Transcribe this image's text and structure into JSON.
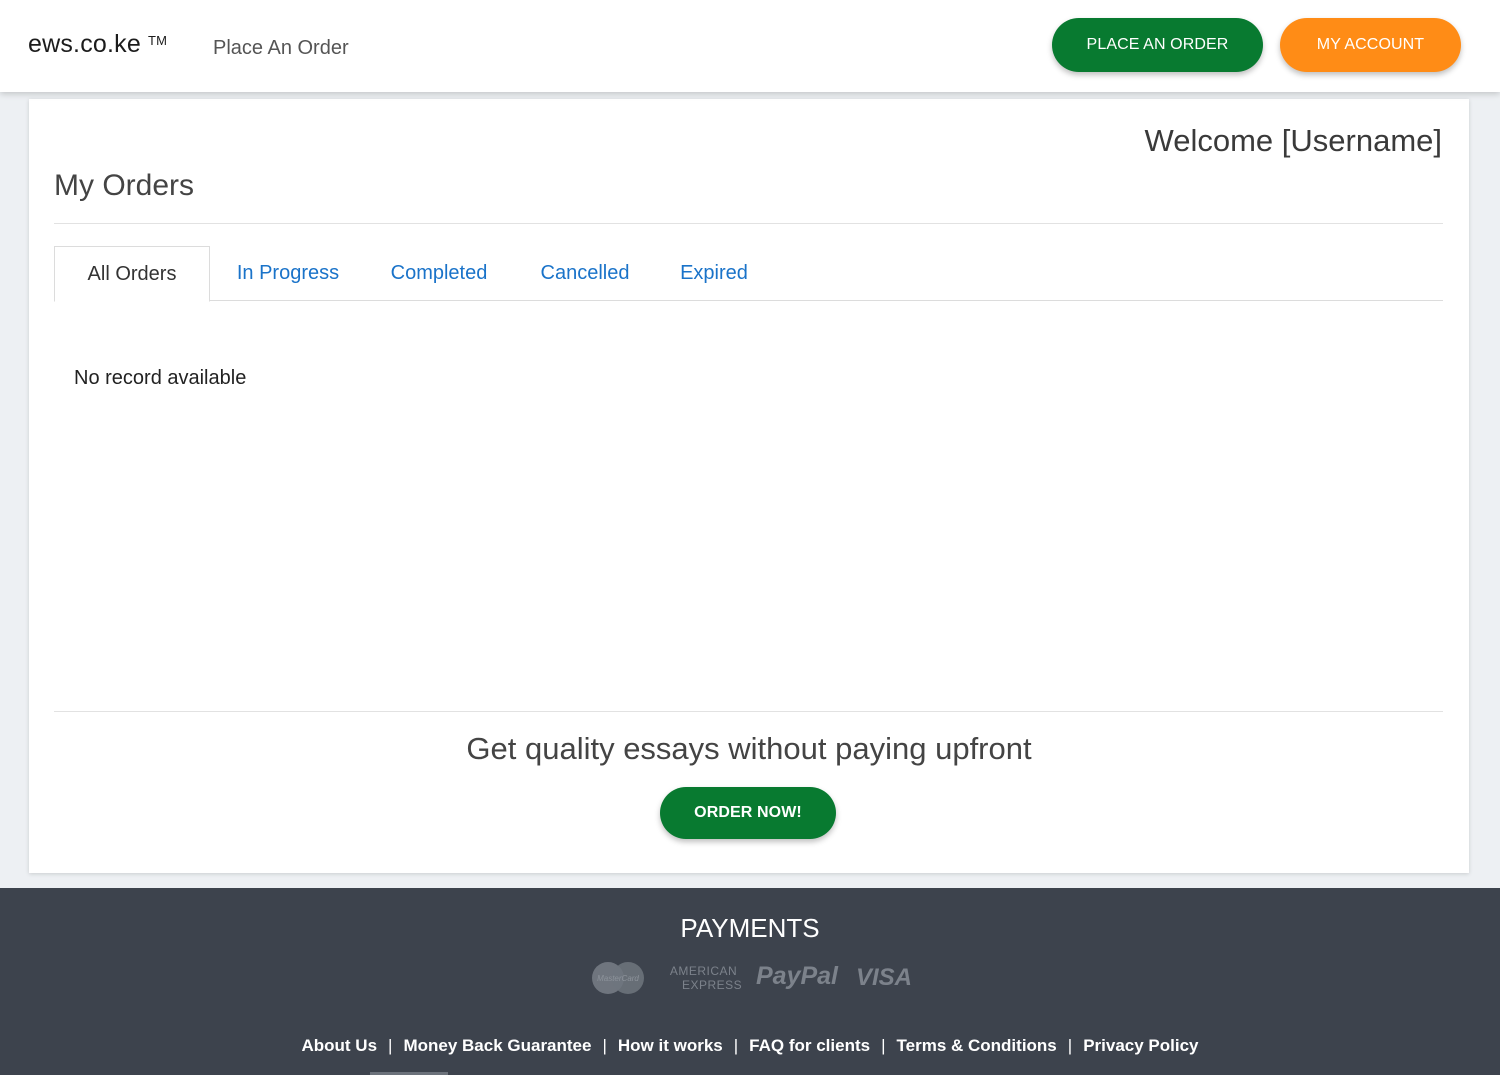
{
  "header": {
    "brand": "ews.co.ke",
    "trademark": "TM",
    "nav_link": "Place An Order",
    "place_order_label": "PLACE AN ORDER",
    "my_account_label": "MY ACCOUNT"
  },
  "main": {
    "welcome": "Welcome [Username]",
    "title": "My Orders",
    "tabs": [
      {
        "label": "All Orders",
        "active": true
      },
      {
        "label": "In Progress",
        "active": false
      },
      {
        "label": "Completed",
        "active": false
      },
      {
        "label": "Cancelled",
        "active": false
      },
      {
        "label": "Expired",
        "active": false
      }
    ],
    "empty_message": "No record available",
    "promo_text": "Get quality essays without paying upfront",
    "order_now_label": "ORDER NOW!"
  },
  "footer": {
    "payments_heading": "PAYMENTS",
    "payment_logos": {
      "mastercard": "MasterCard",
      "amex_line1": "AMERICAN",
      "amex_line2": "EXPRESS",
      "paypal": "PayPal",
      "visa": "VISA"
    },
    "links": [
      "About Us",
      "Money Back Guarantee",
      "How it works",
      "FAQ for clients",
      "Terms & Conditions",
      "Privacy Policy"
    ]
  },
  "colors": {
    "primary_green": "#087a30",
    "accent_orange": "#ff8c16",
    "tab_link_blue": "#1a73c9",
    "footer_bg": "#3d434d"
  }
}
